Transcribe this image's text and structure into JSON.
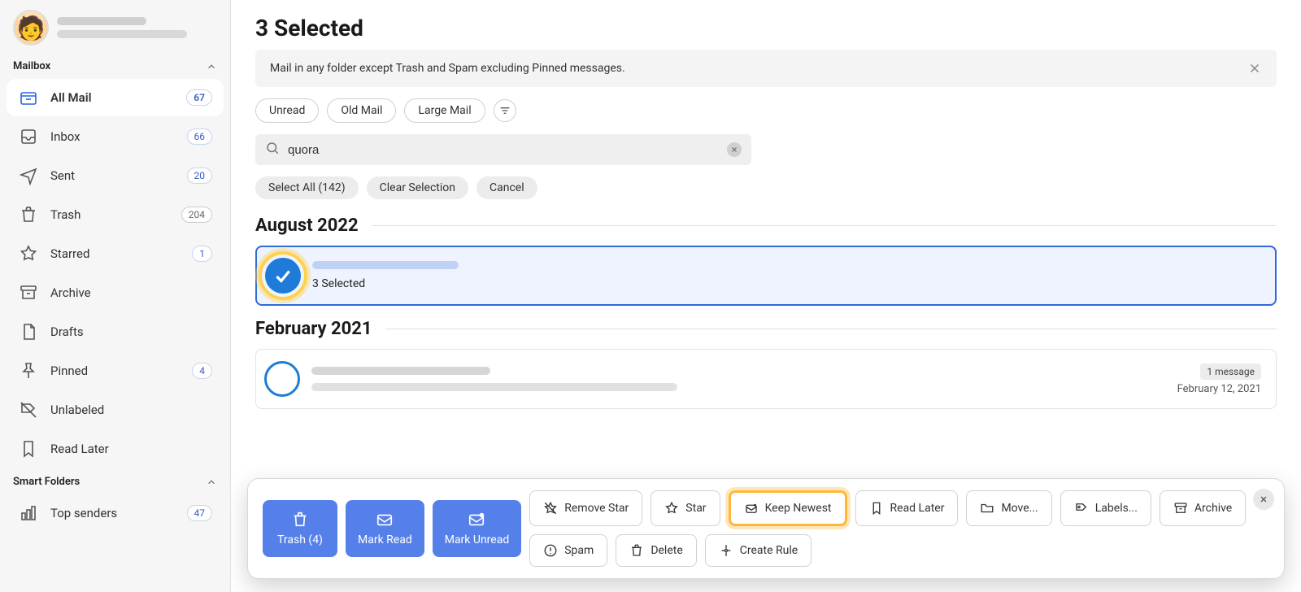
{
  "sidebar": {
    "section1_label": "Mailbox",
    "section2_label": "Smart Folders",
    "items": [
      {
        "label": "All Mail",
        "count": "67",
        "active": true
      },
      {
        "label": "Inbox",
        "count": "66",
        "active": false
      },
      {
        "label": "Sent",
        "count": "20",
        "active": false
      },
      {
        "label": "Trash",
        "count": "204",
        "active": false
      },
      {
        "label": "Starred",
        "count": "1",
        "active": false
      },
      {
        "label": "Archive",
        "count": "",
        "active": false
      },
      {
        "label": "Drafts",
        "count": "",
        "active": false
      },
      {
        "label": "Pinned",
        "count": "4",
        "active": false
      },
      {
        "label": "Unlabeled",
        "count": "",
        "active": false
      },
      {
        "label": "Read Later",
        "count": "",
        "active": false
      }
    ],
    "smart": [
      {
        "label": "Top senders",
        "count": "47"
      }
    ]
  },
  "header": {
    "title": "3 Selected",
    "info_message": "Mail in any folder except Trash and Spam excluding Pinned messages."
  },
  "filters": {
    "chips": [
      "Unread",
      "Old Mail",
      "Large Mail"
    ]
  },
  "search": {
    "value": "quora"
  },
  "selection_row": {
    "select_all": "Select All (142)",
    "clear": "Clear Selection",
    "cancel": "Cancel"
  },
  "groups": [
    {
      "title": "August 2022",
      "card": {
        "selected": true,
        "subtitle": "3 Selected"
      }
    },
    {
      "title": "February 2021",
      "card": {
        "selected": false,
        "meta_badge": "1 message",
        "meta_date": "February 12, 2021"
      }
    }
  ],
  "actionbar": {
    "primary": [
      {
        "label": "Trash (4)"
      },
      {
        "label": "Mark Read"
      },
      {
        "label": "Mark Unread"
      }
    ],
    "row1": [
      {
        "label": "Remove Star"
      },
      {
        "label": "Star"
      },
      {
        "label": "Keep Newest",
        "highlight": true
      },
      {
        "label": "Read Later"
      },
      {
        "label": "Move..."
      },
      {
        "label": "Labels..."
      },
      {
        "label": "Archive"
      }
    ],
    "row2": [
      {
        "label": "Spam"
      },
      {
        "label": "Delete"
      },
      {
        "label": "Create Rule"
      }
    ]
  }
}
